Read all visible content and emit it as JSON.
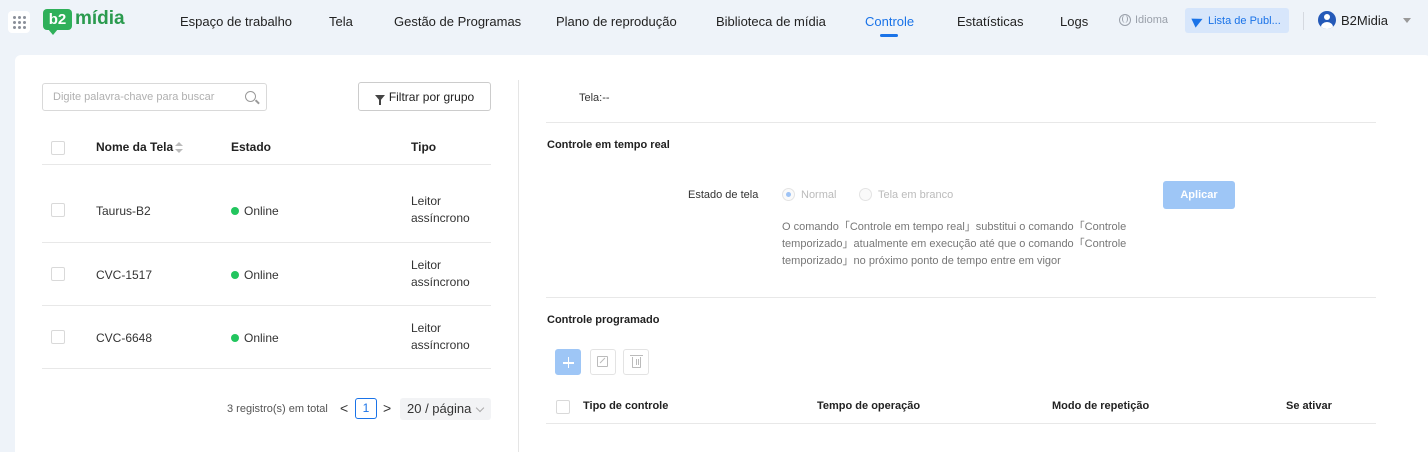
{
  "header": {
    "logo_badge": "b2",
    "logo_text": "mídia",
    "nav": [
      {
        "label": "Espaço de trabalho"
      },
      {
        "label": "Tela"
      },
      {
        "label": "Gestão de Programas"
      },
      {
        "label": "Plano de reprodução"
      },
      {
        "label": "Biblioteca de mídia"
      },
      {
        "label": "Controle",
        "active": true
      },
      {
        "label": "Estatísticas"
      },
      {
        "label": "Logs"
      }
    ],
    "language_label": "Idioma",
    "publish_list_label": "Lista de Publ...",
    "user_name": "B2Midia",
    "accent_color": "#1a73e8"
  },
  "left": {
    "search_placeholder": "Digite palavra-chave para buscar",
    "filter_button": "Filtrar por grupo",
    "columns": [
      "Nome da Tela",
      "Estado",
      "Tipo"
    ],
    "rows": [
      {
        "name": "Taurus-B2",
        "status": "Online",
        "type": "Leitor assíncrono"
      },
      {
        "name": "CVC-1517",
        "status": "Online",
        "type": "Leitor assíncrono"
      },
      {
        "name": "CVC-6648",
        "status": "Online",
        "type": "Leitor assíncrono"
      }
    ],
    "status_color": "#22c55e",
    "pagination": {
      "total_text": "3 registro(s) em total",
      "prev": "<",
      "current_page": "1",
      "next": ">",
      "page_size": "20 / página"
    }
  },
  "right": {
    "screen_label": "Tela:--",
    "realtime_title": "Controle em tempo real",
    "screen_state_label": "Estado de tela",
    "radio_normal": "Normal",
    "radio_blank": "Tela em branco",
    "apply_button": "Aplicar",
    "help_text": "O comando「Controle em tempo real」substitui o comando「Controle temporizado」atualmente em execução até que o comando「Controle temporizado」no próximo ponto de tempo entre em vigor",
    "scheduled_title": "Controle programado",
    "schedule_columns": [
      "Tipo de controle",
      "Tempo de operação",
      "Modo de repetição",
      "Se ativar"
    ]
  }
}
